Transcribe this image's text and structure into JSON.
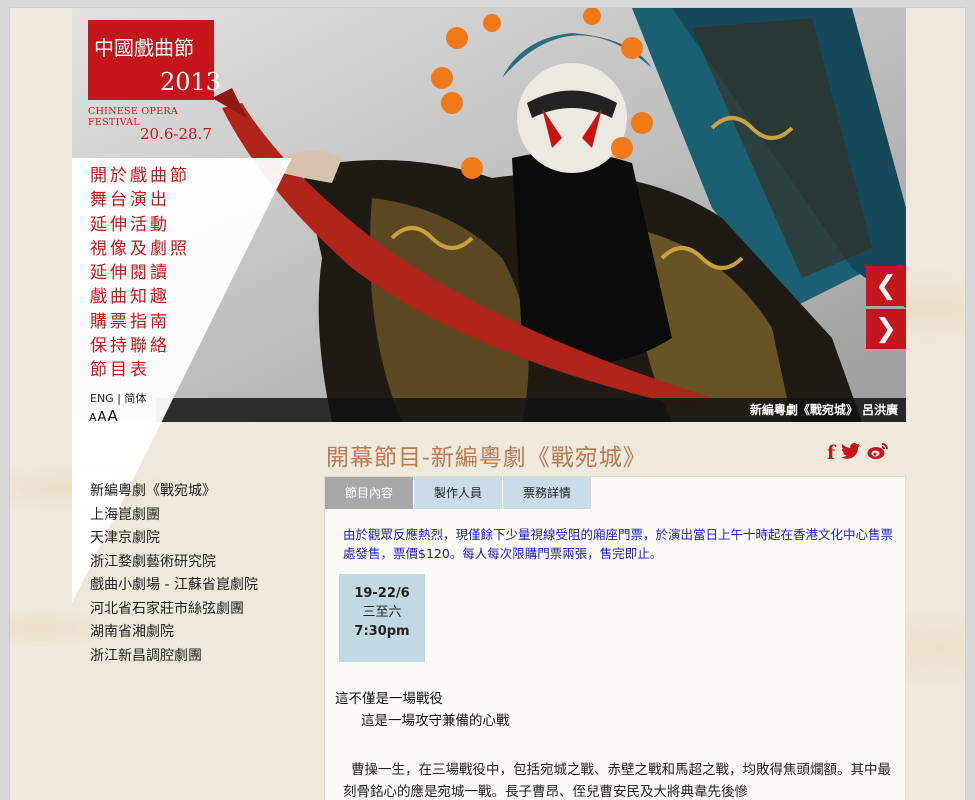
{
  "logo": {
    "chars": "中國戲曲節",
    "year": "2013",
    "english": "CHINESE OPERA FESTIVAL",
    "dates": "20.6-28.7"
  },
  "hero": {
    "caption": "新編粵劇《戰宛城》 呂洪廣",
    "prev_icon": "❮",
    "next_icon": "❯"
  },
  "sidenav": {
    "items": [
      "開於戲曲節",
      "舞台演出",
      "延伸活動",
      "視像及劇照",
      "延伸閱讀",
      "戲曲知趣",
      "購票指南",
      "保持聯絡",
      "節目表"
    ],
    "lang_eng": "ENG",
    "lang_sep": " | ",
    "lang_sc": "简体",
    "font_small": "A",
    "font_medium": "A",
    "font_large": "A"
  },
  "programs": [
    "新編粵劇《戰宛城》",
    "上海崑劇團",
    "天津京劇院",
    "浙江婺劇藝術研究院",
    "戲曲小劇場 - 江蘇省崑劇院",
    "河北省石家莊市絲弦劇團",
    "湖南省湘劇院",
    "浙江新昌調腔劇團"
  ],
  "title": "開幕節目-新編粵劇《戰宛城》",
  "social": {
    "facebook": "f",
    "twitter": "t",
    "weibo": "w"
  },
  "tabs": [
    "節目內容",
    "製作人員",
    "票務詳情"
  ],
  "notice": "由於觀眾反應熱烈，現僅餘下少量視線受阻的廂座門票，於演出當日上午十時起在香港文化中心售票處發售，票價$120。每人每次限購門票兩張，售完即止。",
  "schedule": {
    "dates": "19-22/6",
    "days": "三至六",
    "time": "7:30pm"
  },
  "intro": {
    "line1": "這不僅是一場戰役",
    "line2": "這是一場攻守兼備的心戰"
  },
  "body": "曹操一生，在三場戰役中，包括宛城之戰、赤壁之戰和馬超之戰，均敗得焦頭爛額。其中最刻骨銘心的應是宛城一戰。長子曹昂、侄兒曹安民及大將典韋先後慘",
  "colors": {
    "accent": "#c4161c",
    "title": "#b97a55",
    "notice": "#1a1acc",
    "tab_active": "#a8a8a8",
    "tab_inactive": "#c8dde8"
  }
}
